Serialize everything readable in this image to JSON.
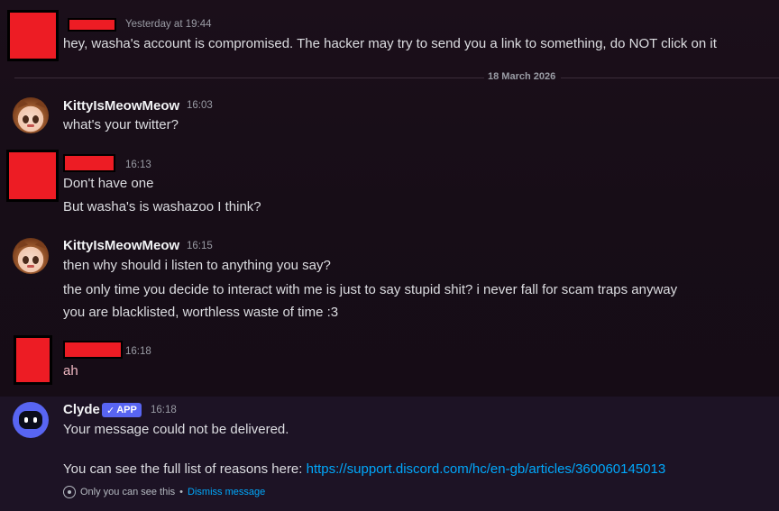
{
  "messages": [
    {
      "time": "Yesterday at 19:44",
      "lines": [
        "hey, washa's account is compromised. The hacker may try to send you a link to something, do NOT click on it"
      ]
    },
    {
      "author": "KittyIsMeowMeow",
      "time": "16:03",
      "lines": [
        "what's your twitter?"
      ]
    },
    {
      "time": "16:13",
      "lines": [
        "Don't have one",
        "But washa's is washazoo I think?"
      ]
    },
    {
      "author": "KittyIsMeowMeow",
      "time": "16:15",
      "lines": [
        "then why should i listen to anything you say?",
        "the only time you decide to interact with me is just to say stupid shit? i never fall for scam traps anyway",
        "you are blacklisted, worthless waste of time :3"
      ]
    },
    {
      "time": "16:18",
      "lines": [
        "ah"
      ]
    }
  ],
  "divider": {
    "label": "18 March 2026"
  },
  "clyde": {
    "author": "Clyde",
    "badge": "APP",
    "badge_icon": "✓",
    "time": "16:18",
    "line1": "Your message could not be delivered.",
    "line2_prefix": "You can see the full list of reasons here: ",
    "link": "https://support.discord.com/hc/en-gb/articles/360060145013",
    "ephemeral_text": "Only you can see this",
    "ephemeral_sep": "•",
    "dismiss": "Dismiss message"
  },
  "colors": {
    "background": "#170d17",
    "redaction": "#ed1c24",
    "link": "#00a8fc",
    "brand": "#5865f2"
  }
}
